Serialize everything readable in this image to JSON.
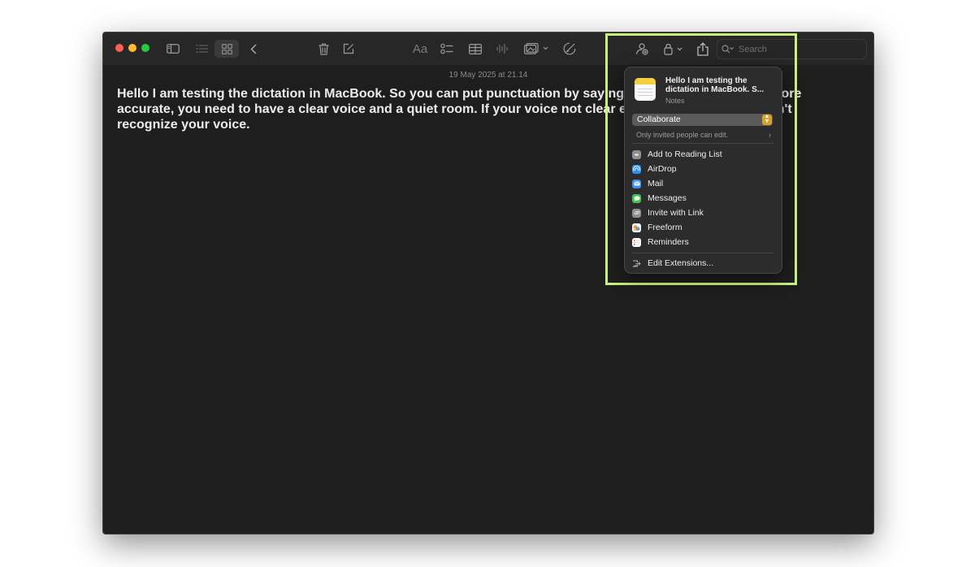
{
  "window": {
    "note_date": "19 May 2025 at 21.14",
    "note_text": "Hello I am testing the dictation in MacBook. So you can put punctuation by saying the punctuation. To be more accurate, you need to have a clear voice and a quiet room. If your voice not clear enough then MacBook can't recognize your voice.",
    "toolbar": {
      "format_label": "Aa",
      "search_placeholder": "Search"
    }
  },
  "share_popover": {
    "note_title": "Hello I am testing the dictation in MacBook. S...",
    "app_name": "Notes",
    "collaborate_label": "Collaborate",
    "permission_text": "Only invited people can edit.",
    "items": [
      {
        "label": "Add to Reading List",
        "icon": "reading-list-icon",
        "color": "#8e8e93"
      },
      {
        "label": "AirDrop",
        "icon": "airdrop-icon",
        "color": "#2d8ef0"
      },
      {
        "label": "Mail",
        "icon": "mail-icon",
        "color": "#3b8ff1"
      },
      {
        "label": "Messages",
        "icon": "messages-icon",
        "color": "#3dc54e"
      },
      {
        "label": "Invite with Link",
        "icon": "link-icon",
        "color": "#8e8e93"
      },
      {
        "label": "Freeform",
        "icon": "freeform-icon",
        "color": "#ffffff"
      },
      {
        "label": "Reminders",
        "icon": "reminders-icon",
        "color": "#ffffff"
      }
    ],
    "edit_extensions_label": "Edit Extensions..."
  },
  "colors": {
    "highlight": "#c9f37a",
    "close": "#ff5f57",
    "minimize": "#febc2e",
    "zoom": "#28c840"
  }
}
